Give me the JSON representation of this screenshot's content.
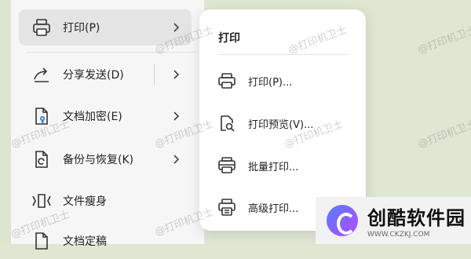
{
  "menu": {
    "items": [
      {
        "label": "打印(P)",
        "icon": "printer-icon"
      },
      {
        "label": "分享发送(D)",
        "icon": "share-icon"
      },
      {
        "label": "文档加密(E)",
        "icon": "document-lock-icon"
      },
      {
        "label": "备份与恢复(K)",
        "icon": "backup-restore-icon"
      },
      {
        "label": "文件瘦身",
        "icon": "file-slim-icon"
      },
      {
        "label": "文档定稿",
        "icon": "document-finalize-icon"
      }
    ]
  },
  "submenu": {
    "title": "打印",
    "items": [
      {
        "label": "打印(P)...",
        "icon": "printer-icon"
      },
      {
        "label": "打印预览(V)...",
        "icon": "print-preview-icon"
      },
      {
        "label": "批量打印...",
        "icon": "batch-print-icon"
      },
      {
        "label": "高级打印...",
        "icon": "advanced-print-icon"
      }
    ]
  },
  "watermark_text": "@打印机卫士",
  "logo": {
    "name": "创酷软件园",
    "url": "WWW.CKZKJ.COM"
  },
  "colors": {
    "background": "#dfe6d2",
    "menu_bg": "#f6f6f6",
    "active_item_bg": "#e4e4e4",
    "submenu_bg": "#ffffff"
  }
}
